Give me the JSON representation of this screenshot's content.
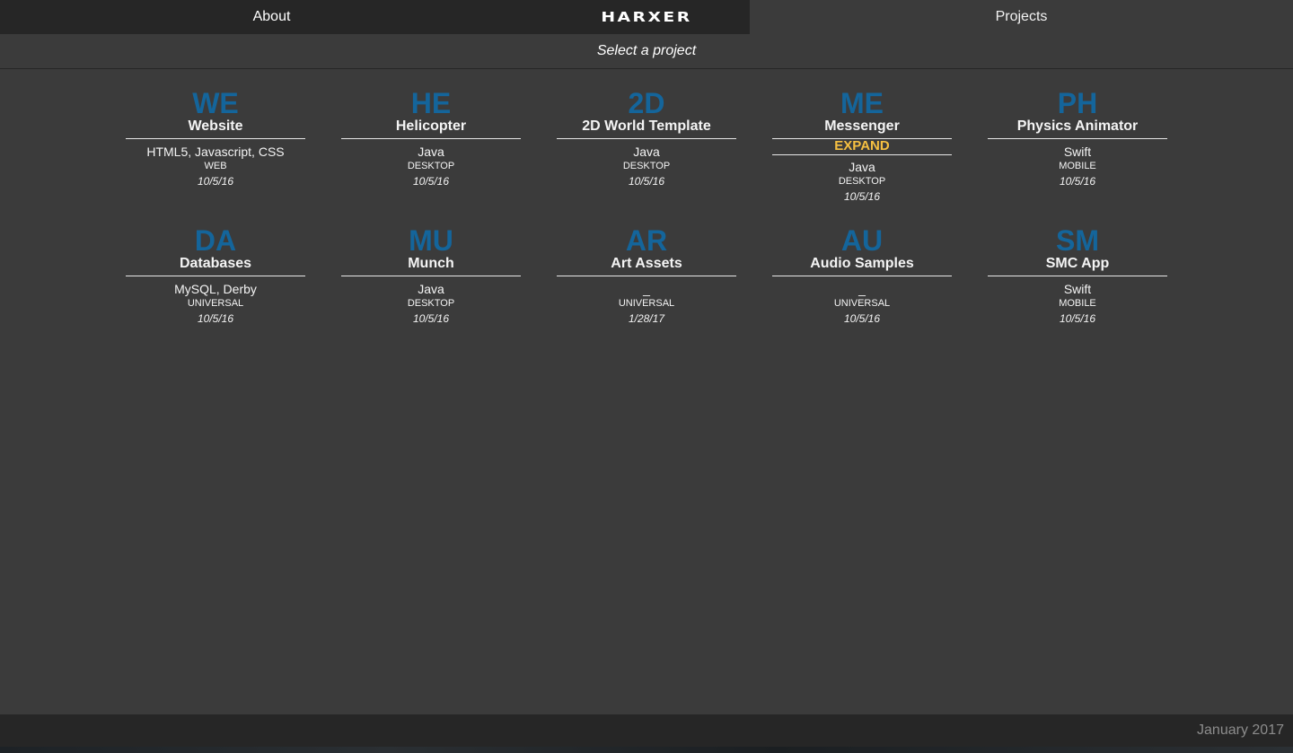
{
  "nav": {
    "about_label": "About",
    "logo_text": "HARXER",
    "projects_label": "Projects"
  },
  "subheader": {
    "text": "Select a project"
  },
  "colors": {
    "accent_blue": "#14659b",
    "expand_yellow": "#f6c041",
    "background": "#3b3b3b",
    "bar": "#262626"
  },
  "projects": [
    {
      "abbr": "WE",
      "name": "Website",
      "tech": "HTML5, Javascript, CSS",
      "platform": "WEB",
      "date": "10/5/16"
    },
    {
      "abbr": "HE",
      "name": "Helicopter",
      "tech": "Java",
      "platform": "DESKTOP",
      "date": "10/5/16"
    },
    {
      "abbr": "2D",
      "name": "2D World Template",
      "tech": "Java",
      "platform": "DESKTOP",
      "date": "10/5/16"
    },
    {
      "abbr": "ME",
      "name": "Messenger",
      "expand": "EXPAND",
      "tech": "Java",
      "platform": "DESKTOP",
      "date": "10/5/16"
    },
    {
      "abbr": "PH",
      "name": "Physics Animator",
      "tech": "Swift",
      "platform": "MOBILE",
      "date": "10/5/16"
    },
    {
      "abbr": "DA",
      "name": "Databases",
      "tech": "MySQL, Derby",
      "platform": "UNIVERSAL",
      "date": "10/5/16"
    },
    {
      "abbr": "MU",
      "name": "Munch",
      "tech": "Java",
      "platform": "DESKTOP",
      "date": "10/5/16"
    },
    {
      "abbr": "AR",
      "name": "Art Assets",
      "tech": "_",
      "platform": "UNIVERSAL",
      "date": "1/28/17"
    },
    {
      "abbr": "AU",
      "name": "Audio Samples",
      "tech": "_",
      "platform": "UNIVERSAL",
      "date": "10/5/16"
    },
    {
      "abbr": "SM",
      "name": "SMC App",
      "tech": "Swift",
      "platform": "MOBILE",
      "date": "10/5/16"
    }
  ],
  "footer": {
    "text": "January 2017"
  }
}
